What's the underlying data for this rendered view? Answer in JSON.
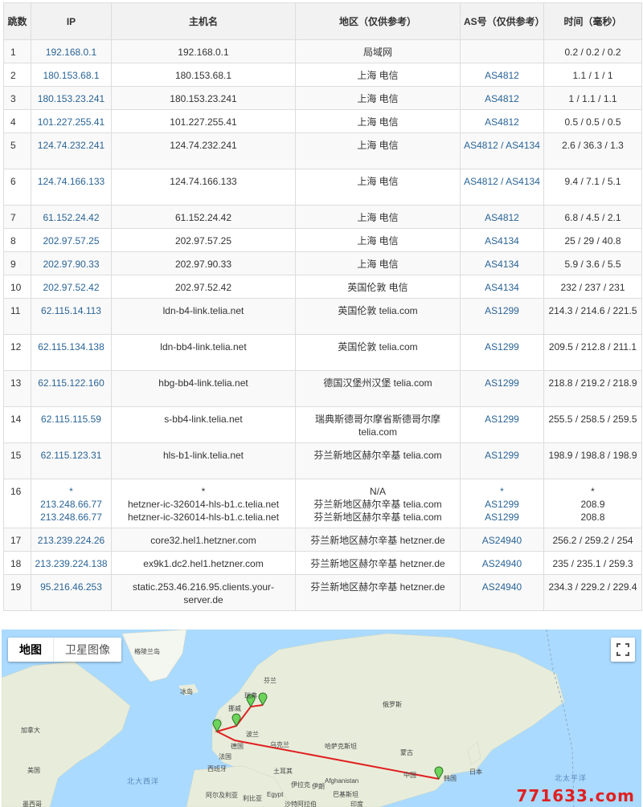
{
  "table": {
    "headers": {
      "hop": "跳数",
      "ip": "IP",
      "host": "主机名",
      "region": "地区（仅供参考）",
      "as": "AS号（仅供参考）",
      "time": "时间（毫秒）"
    },
    "rows": [
      {
        "hop": "1",
        "ip": "192.168.0.1",
        "host": "192.168.0.1",
        "region": "局域网",
        "as": "",
        "time": "0.2 / 0.2 / 0.2"
      },
      {
        "hop": "2",
        "ip": "180.153.68.1",
        "host": "180.153.68.1",
        "region": "上海 电信",
        "as": "AS4812",
        "time": "1.1 / 1 / 1"
      },
      {
        "hop": "3",
        "ip": "180.153.23.241",
        "host": "180.153.23.241",
        "region": "上海 电信",
        "as": "AS4812",
        "time": "1 / 1.1 / 1.1"
      },
      {
        "hop": "4",
        "ip": "101.227.255.41",
        "host": "101.227.255.41",
        "region": "上海 电信",
        "as": "AS4812",
        "time": "0.5 / 0.5 / 0.5"
      },
      {
        "hop": "5",
        "ip": "124.74.232.241",
        "host": "124.74.232.241",
        "region": "上海 电信",
        "as": "AS4812 / AS4134",
        "time": "2.6 / 36.3 / 1.3"
      },
      {
        "hop": "6",
        "ip": "124.74.166.133",
        "host": "124.74.166.133",
        "region": "上海 电信",
        "as": "AS4812 / AS4134",
        "time": "9.4 / 7.1 / 5.1"
      },
      {
        "hop": "7",
        "ip": "61.152.24.42",
        "host": "61.152.24.42",
        "region": "上海 电信",
        "as": "AS4812",
        "time": "6.8 / 4.5 / 2.1"
      },
      {
        "hop": "8",
        "ip": "202.97.57.25",
        "host": "202.97.57.25",
        "region": "上海 电信",
        "as": "AS4134",
        "time": "25 / 29 / 40.8"
      },
      {
        "hop": "9",
        "ip": "202.97.90.33",
        "host": "202.97.90.33",
        "region": "上海 电信",
        "as": "AS4134",
        "time": "5.9 / 3.6 / 5.5"
      },
      {
        "hop": "10",
        "ip": "202.97.52.42",
        "host": "202.97.52.42",
        "region": "英国伦敦 电信",
        "as": "AS4134",
        "time": "232 / 237 / 231"
      },
      {
        "hop": "11",
        "ip": "62.115.14.113",
        "host": "ldn-b4-link.telia.net",
        "region": "英国伦敦 telia.com",
        "as": "AS1299",
        "time": "214.3 / 214.6 / 221.5"
      },
      {
        "hop": "12",
        "ip": "62.115.134.138",
        "host": "ldn-bb4-link.telia.net",
        "region": "英国伦敦 telia.com",
        "as": "AS1299",
        "time": "209.5 / 212.8 / 211.1"
      },
      {
        "hop": "13",
        "ip": "62.115.122.160",
        "host": "hbg-bb4-link.telia.net",
        "region": "德国汉堡州汉堡 telia.com",
        "as": "AS1299",
        "time": "218.8 / 219.2 / 218.9"
      },
      {
        "hop": "14",
        "ip": "62.115.115.59",
        "host": "s-bb4-link.telia.net",
        "region": "瑞典斯德哥尔摩省斯德哥尔摩 telia.com",
        "as": "AS1299",
        "time": "255.5 / 258.5 / 259.5"
      },
      {
        "hop": "15",
        "ip": "62.115.123.31",
        "host": "hls-b1-link.telia.net",
        "region": "芬兰新地区赫尔辛基 telia.com",
        "as": "AS1299",
        "time": "198.9 / 198.8 / 198.9"
      },
      {
        "hop": "16",
        "ip": "*\n213.248.66.77\n213.248.66.77",
        "host": "*\nhetzner-ic-326014-hls-b1.c.telia.net\nhetzner-ic-326014-hls-b1.c.telia.net",
        "region": "N/A\n芬兰新地区赫尔辛基 telia.com\n芬兰新地区赫尔辛基 telia.com",
        "as": "*\nAS1299\nAS1299",
        "time": "*\n208.9\n208.8"
      },
      {
        "hop": "17",
        "ip": "213.239.224.26",
        "host": "core32.hel1.hetzner.com",
        "region": "芬兰新地区赫尔辛基 hetzner.de",
        "as": "AS24940",
        "time": "256.2 / 259.2 / 254"
      },
      {
        "hop": "18",
        "ip": "213.239.224.138",
        "host": "ex9k1.dc2.hel1.hetzner.com",
        "region": "芬兰新地区赫尔辛基 hetzner.de",
        "as": "AS24940",
        "time": "235 / 235.1 / 259.3"
      },
      {
        "hop": "19",
        "ip": "95.216.46.253",
        "host": "static.253.46.216.95.clients.your-server.de",
        "region": "芬兰新地区赫尔辛基 hetzner.de",
        "as": "AS24940",
        "time": "234.3 / 229.2 / 229.4"
      }
    ]
  },
  "map": {
    "tab_map": "地图",
    "tab_satellite": "卫星图像",
    "fullscreen_icon": "fullscreen-icon",
    "labels": {
      "greenland": "格陵兰岛",
      "iceland": "冰岛",
      "canada": "加拿大",
      "usa": "美国",
      "mexico": "墨西哥",
      "north_atlantic": "北大西洋",
      "north_pacific": "北太平洋",
      "finland": "芬兰",
      "sweden": "瑞典",
      "norway": "挪威",
      "russia": "俄罗斯",
      "poland": "波兰",
      "ukraine": "乌克兰",
      "germany": "德国",
      "france": "法国",
      "spain": "西班牙",
      "turkey": "土耳其",
      "iraq": "伊拉克",
      "iran": "伊朗",
      "egypt": "Egypt",
      "afghanistan": "Afghanistan",
      "pakistan": "巴基斯坦",
      "india": "印度",
      "mongolia": "蒙古",
      "china": "中国",
      "japan": "日本",
      "korea": "韩国",
      "algeria": "阿尔及利亚",
      "libya": "利比亚",
      "saudi": "沙特阿拉伯",
      "kazakhstan": "哈萨克斯坦"
    },
    "marker_color": "#6cd45a",
    "route_color": "#e02020",
    "ocean_color": "#aadaff",
    "land_color": "#e8eddb"
  },
  "watermark": "771633.com"
}
